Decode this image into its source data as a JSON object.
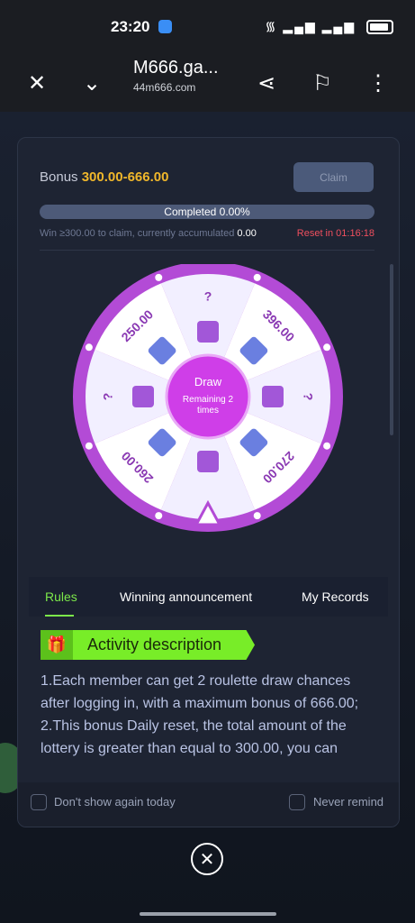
{
  "status": {
    "time": "23:20"
  },
  "browser": {
    "title": "M666.ga...",
    "url": "44m666.com"
  },
  "bonus": {
    "label": "Bonus",
    "range": "300.00-666.00",
    "claim": "Claim"
  },
  "progress": {
    "text": "Completed 0.00%",
    "value": 0
  },
  "info": {
    "left": "Win ≥300.00 to claim, currently accumulated",
    "accumulated": "0.00",
    "reset": "Reset in 01:16:18"
  },
  "wheel": {
    "segments": [
      "?",
      "396.00",
      "?",
      "270.00",
      "",
      "260.00",
      "?",
      "250.00"
    ],
    "draw": "Draw",
    "remaining": "Remaining 2 times",
    "colors": {
      "rim": "#b34bd6",
      "light": "#f2efff",
      "dark": "#ffffff",
      "center": "#cf3ee8",
      "label": "#8a39b3"
    }
  },
  "tabs": [
    "Rules",
    "Winning announcement",
    "My Records"
  ],
  "activity": {
    "title": "Activity description"
  },
  "rules": [
    "1.Each member can get 2 roulette draw chances after logging in, with a maximum bonus of 666.00;",
    "2.This bonus Daily reset, the total amount of the lottery is greater than equal to 300.00, you can"
  ],
  "options": {
    "dont_show": "Don't show again today",
    "never": "Never remind"
  }
}
